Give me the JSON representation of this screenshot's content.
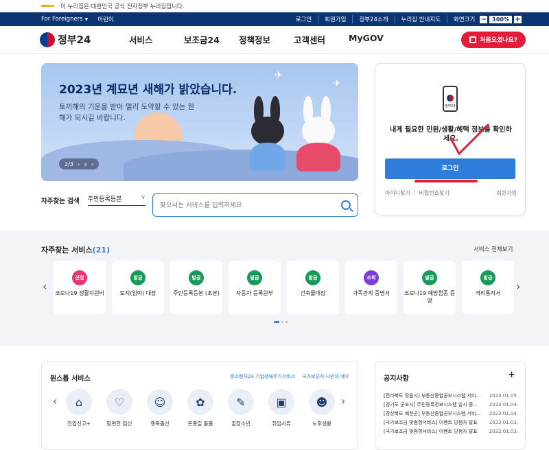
{
  "gov_strip": {
    "text": "이 누리집은 대한민국 공식 전자정부 누리집입니다."
  },
  "util": {
    "left": [
      "For Foreigners",
      "어린이"
    ],
    "right": [
      "로그인",
      "회원가입",
      "정부24소개",
      "누리집 안내지도",
      "화면크기"
    ],
    "zoom_minus": "−",
    "zoom_value": "100%",
    "zoom_plus": "+"
  },
  "nav": {
    "logo": "정부24",
    "items": [
      "서비스",
      "보조금24",
      "정책정보",
      "고객센터",
      "MyGOV"
    ],
    "cta": "처음오셨나요?"
  },
  "hero": {
    "title": "2023년 계묘년 새해가 밝았습니다.",
    "text": "토끼해의 기운을 받아 멀리 도약할 수 있는 한 해가 되시길 바랍니다.",
    "pager": "2/3"
  },
  "login": {
    "icon_label": "정부24",
    "message": "내게 필요한 민원/생활/혜택 정보를 확인하세요.",
    "button": "로그인",
    "link_id": "아이디찾기",
    "link_pw": "비밀번호찾기",
    "link_join": "회원가입"
  },
  "search": {
    "label": "자주찾는 검색",
    "select": "주민등록등본",
    "placeholder": "찾으시는 서비스를 입력하세요"
  },
  "services": {
    "title": "자주찾는 서비스",
    "count": "(21)",
    "view_all": "서비스 전체보기",
    "items": [
      {
        "badge": "신청",
        "color": "#e8356b",
        "name": "코로나19 생활지원비"
      },
      {
        "badge": "발급",
        "color": "#179a5a",
        "name": "토지(임야) 대장"
      },
      {
        "badge": "발급",
        "color": "#179a5a",
        "name": "주민등록등본 (초본)"
      },
      {
        "badge": "발급",
        "color": "#179a5a",
        "name": "자동차 등록원부"
      },
      {
        "badge": "발급",
        "color": "#179a5a",
        "name": "건축물대장"
      },
      {
        "badge": "조회",
        "color": "#7b3fd6",
        "name": "가족관계 증명서"
      },
      {
        "badge": "발급",
        "color": "#179a5a",
        "name": "코로나19 예방접종 증명"
      },
      {
        "badge": "발급",
        "color": "#179a5a",
        "name": "격리통지서"
      }
    ]
  },
  "onestop": {
    "title": "원스톱 서비스",
    "link1": "중소벤처24 기업생애주기서비스",
    "link2": "국가보훈처 나만의 예우",
    "items": [
      {
        "icon": "house-icon",
        "glyph": "⌂",
        "name": "전입신고+"
      },
      {
        "icon": "pregnancy-icon",
        "glyph": "♡",
        "name": "맘편한 임신"
      },
      {
        "icon": "baby-icon",
        "glyph": "☺",
        "name": "행복출산"
      },
      {
        "icon": "ribbon-icon",
        "glyph": "✿",
        "name": "온종일 돌봄"
      },
      {
        "icon": "book-icon",
        "glyph": "✎",
        "name": "꿈정소년"
      },
      {
        "icon": "briefcase-icon",
        "glyph": "▣",
        "name": "취업서류"
      },
      {
        "icon": "elder-icon",
        "glyph": "☻",
        "name": "노후생활"
      }
    ]
  },
  "notice": {
    "title": "공지사항",
    "items": [
      {
        "title": "[전라북도 정읍시] 부동산종합공부시스템 서비...",
        "date": "2023.01.05."
      },
      {
        "title": "[경기도 군포시] 주민등록정보시스템 일시 중...",
        "date": "2023.01.04."
      },
      {
        "title": "[경상북도 예천군] 부동산종합공부시스템 서비...",
        "date": "2023.01.04."
      },
      {
        "title": "[국가보조금 맞춤형서비스] 이벤트 당첨자 발표",
        "date": "2023.01.03."
      },
      {
        "title": "[국가보조금 맞춤형서비스] 이벤트 당첨자 발표",
        "date": "2023.01.03."
      }
    ]
  }
}
